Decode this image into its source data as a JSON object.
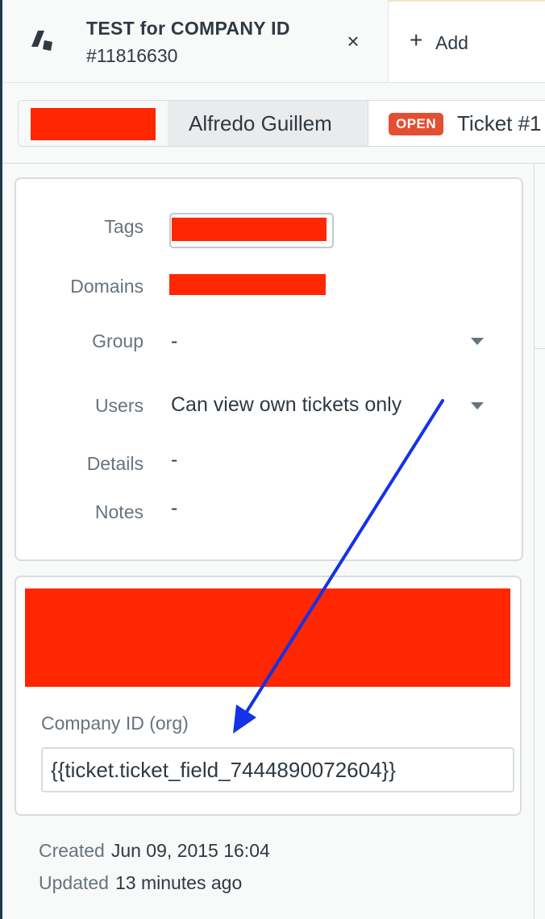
{
  "tab": {
    "title": "TEST for COMPANY ID",
    "subtitle": "#11816630",
    "close_glyph": "×",
    "logo_icon": "zendesk-logo-icon"
  },
  "add_tab": {
    "plus": "+",
    "label": "Add"
  },
  "breadcrumb": {
    "requester": "Alfredo Guillem",
    "status_badge": "OPEN",
    "ticket_label": "Ticket #1"
  },
  "org_fields": {
    "tags_label": "Tags",
    "domains_label": "Domains",
    "group_label": "Group",
    "group_value": "-",
    "users_label": "Users",
    "users_value": "Can view own tickets only",
    "details_label": "Details",
    "details_value": "-",
    "notes_label": "Notes",
    "notes_value": "-"
  },
  "custom_field": {
    "label": "Company ID (org)",
    "value": "{{ticket.ticket_field_7444890072604}}"
  },
  "meta": {
    "created_label": "Created",
    "created_value": "Jun 09, 2015 16:04",
    "updated_label": "Updated",
    "updated_value": "13 minutes ago"
  },
  "colors": {
    "redaction": "#ff2600",
    "badge": "#e34f32",
    "annotation_arrow": "#1432e6"
  }
}
